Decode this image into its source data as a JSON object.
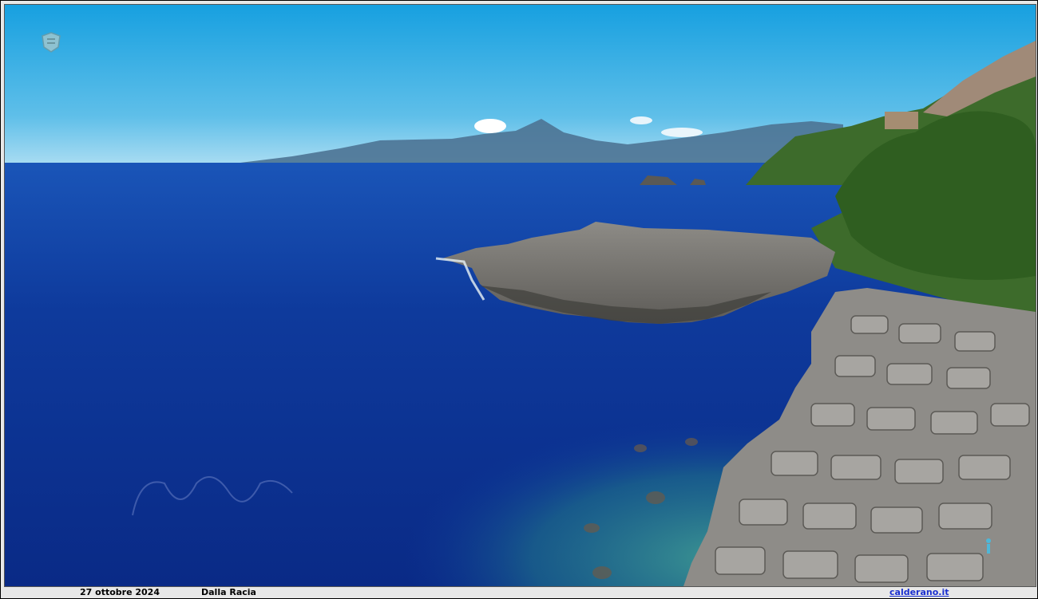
{
  "photo": {
    "subject": "rocky coastline seascape",
    "colors": {
      "sky_top": "#1aa3e0",
      "sky_bottom": "#9fd6f0",
      "sea_deep": "#0a2a86",
      "sea_mid": "#1349a8",
      "sea_shallow": "#2c7f8c",
      "rock": "#7e7c78",
      "vegetation": "#3c6b2a"
    },
    "icons": [
      "watermark-logo-icon",
      "signature-watermark",
      "small-figure-icon"
    ]
  },
  "caption": {
    "date": "27 ottobre 2024",
    "place": "Dalla Racia",
    "site": "calderano.it"
  }
}
